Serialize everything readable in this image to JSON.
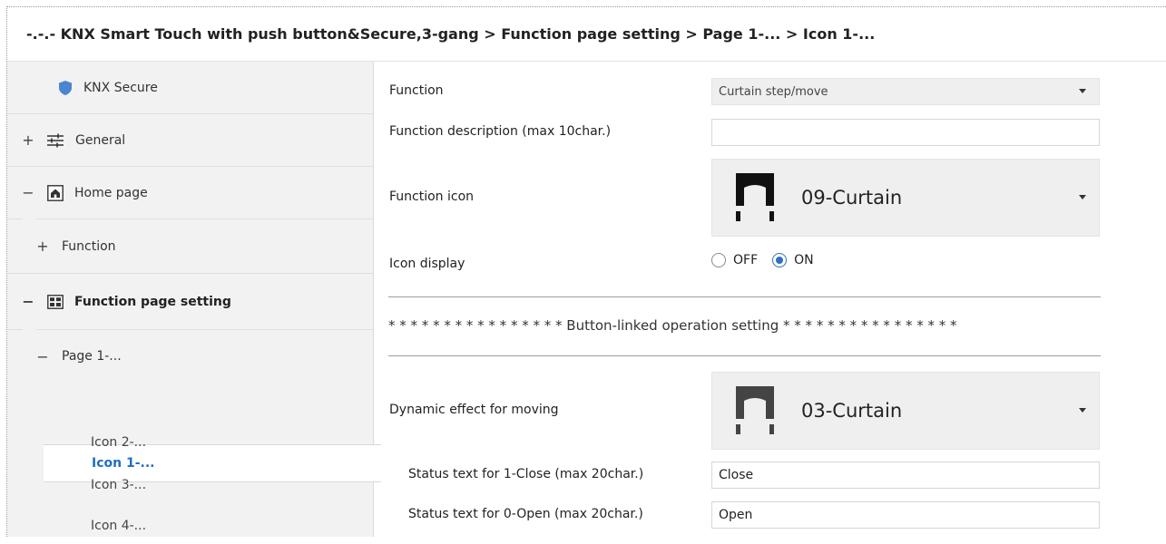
{
  "title": "-.-.- KNX Smart Touch with push button&Secure,3-gang > Function page setting > Page 1-... > Icon 1-...",
  "sidebar": {
    "knx_secure": "KNX Secure",
    "general": "General",
    "home_page": "Home page",
    "function": "Function",
    "function_page_setting": "Function page setting",
    "page1": "Page 1-...",
    "icons": [
      "Icon 1-...",
      "Icon 2-...",
      "Icon 3-...",
      "Icon 4-..."
    ],
    "expanders": {
      "general": "+",
      "home_page": "−",
      "function": "+",
      "function_page_setting": "−",
      "page1": "−"
    }
  },
  "form": {
    "function": {
      "label": "Function",
      "value": "Curtain step/move"
    },
    "function_description": {
      "label": "Function description (max 10char.)",
      "value": ""
    },
    "function_icon": {
      "label": "Function icon",
      "value": "09-Curtain"
    },
    "icon_display": {
      "label": "Icon display",
      "off": "OFF",
      "on": "ON",
      "selected": "ON"
    },
    "section_title": "* * * * * * * * * * * * * * * * Button-linked operation setting * * * * * * * * * * * * * * * *",
    "dynamic_effect": {
      "label": "Dynamic effect for moving",
      "value": "03-Curtain"
    },
    "status_close": {
      "label": "Status text for 1-Close (max 20char.)",
      "value": "Close"
    },
    "status_open": {
      "label": "Status text for 0-Open (max 20char.)",
      "value": "Open"
    }
  },
  "colors": {
    "accent": "#1f6fc2",
    "shield": "#4a86d0",
    "sidebar_bg": "#f2f2f2",
    "select_bg": "#efefef"
  },
  "icons": {
    "knx_secure": "shield-icon",
    "general": "sliders-icon",
    "home_page": "home-icon",
    "function_page_setting": "grid-icon",
    "function_icon": "curtain-icon",
    "dynamic_effect": "curtain-icon"
  }
}
